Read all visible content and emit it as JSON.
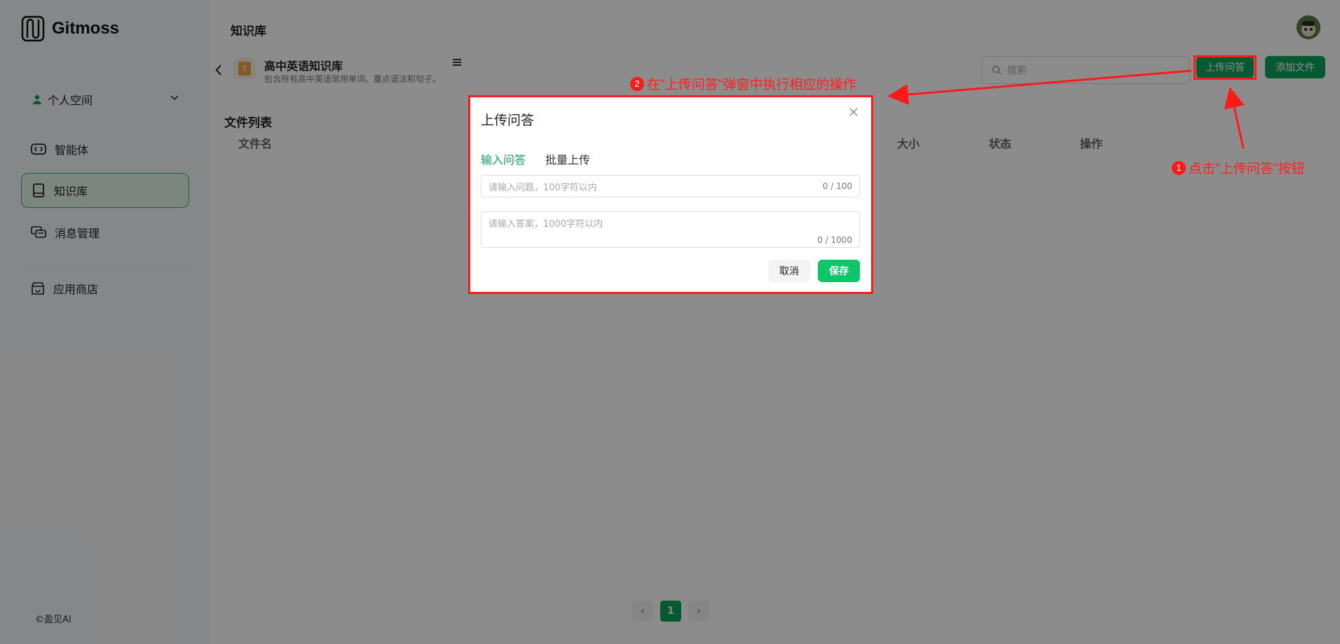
{
  "app": {
    "name": "Gitmoss",
    "copyright": "©盈见AI"
  },
  "sidebar": {
    "space_label": "个人空间",
    "items": [
      {
        "label": "智能体",
        "icon": "agent-icon"
      },
      {
        "label": "知识库",
        "icon": "book-icon"
      },
      {
        "label": "消息管理",
        "icon": "message-icon"
      },
      {
        "label": "应用商店",
        "icon": "store-icon"
      }
    ]
  },
  "header": {
    "title": "知识库"
  },
  "kb": {
    "name": "高中英语知识库",
    "desc": "包含所有高中英语常用单词、重点语法和句子。",
    "icon_letter": "T"
  },
  "search": {
    "placeholder": "搜索"
  },
  "toolbar": {
    "upload_qa": "上传问答",
    "add_file": "添加文件"
  },
  "files": {
    "title": "文件列表",
    "columns": [
      "文件名",
      "大小",
      "状态",
      "操作"
    ]
  },
  "pagination": {
    "current": "1",
    "prev": "‹",
    "next": "›"
  },
  "modal": {
    "title": "上传问答",
    "tabs": [
      "输入问答",
      "批量上传"
    ],
    "question_placeholder": "请输入问题，100字符以内",
    "question_count": "0 / 100",
    "answer_placeholder": "请输入答案，1000字符以内",
    "answer_count": "0 / 1000",
    "cancel": "取消",
    "save": "保存"
  },
  "annotations": {
    "step1_num": "1",
    "step1": "点击\"上传问答\"按钮",
    "step2_num": "2",
    "step2": "在\"上传问答\"弹窗中执行相应的操作"
  },
  "colors": {
    "accent": "#0ea35a",
    "annotation": "#ff1a1a"
  }
}
